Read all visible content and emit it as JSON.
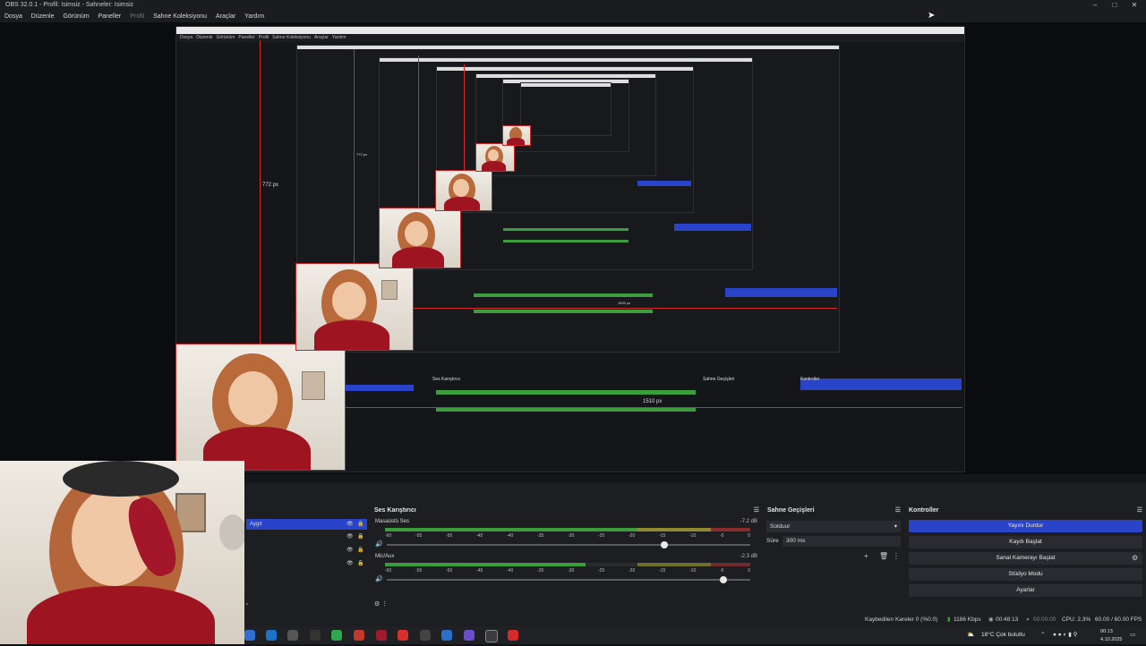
{
  "window": {
    "title": "OBS 32.0.1 - Profil: Isimsiz - Sahneler: Isimsiz"
  },
  "menu": [
    "Dosya",
    "Düzenle",
    "Görünüm",
    "Paneller",
    "Profil",
    "Sahne Koleksiyonu",
    "Araçlar",
    "Yardım"
  ],
  "preview": {
    "measure_label_1": "772 px",
    "measure_label_2": "1510 px",
    "inner_measure_1": "772 px",
    "inner_measure_2": "1500 px"
  },
  "mixer": {
    "title": "Ses Karıştırıcı",
    "channels": [
      {
        "name": "Masaüstü Ses",
        "db": "-7.2 dB",
        "level": 0.68
      },
      {
        "name": "Mic/Aux",
        "db": "-2.3 dB",
        "level": 0.55
      }
    ],
    "ticks": [
      "-60",
      "-55",
      "-50",
      "-45",
      "-40",
      "-35",
      "-30",
      "-25",
      "-20",
      "-15",
      "-10",
      "-5",
      "0"
    ]
  },
  "transitions": {
    "title": "Sahne Geçişleri",
    "selected": "Solduur",
    "duration_label": "Süre",
    "duration_value": "300 ms"
  },
  "controls": {
    "title": "Kontroller",
    "buttons": [
      "Yayını Durdur",
      "Kaydı Başlat",
      "Sanal Kamerayı Başlat",
      "Stüdyo Modu",
      "Ayarlar"
    ]
  },
  "sources": {
    "selected_label": "Aygıt"
  },
  "status": {
    "dropped": "Kaybedilen Kareler 0 (%0.0)",
    "bitrate": "1186 Kbps",
    "stream_time": "00:48:13",
    "rec_time": "00:00:00",
    "cpu": "CPU: 2.3%",
    "fps": "60.00 / 60.00 FPS"
  },
  "taskbar": {
    "weather": "18°C Çok bulutlu",
    "time": "00:13",
    "date": "4.10.2025"
  }
}
